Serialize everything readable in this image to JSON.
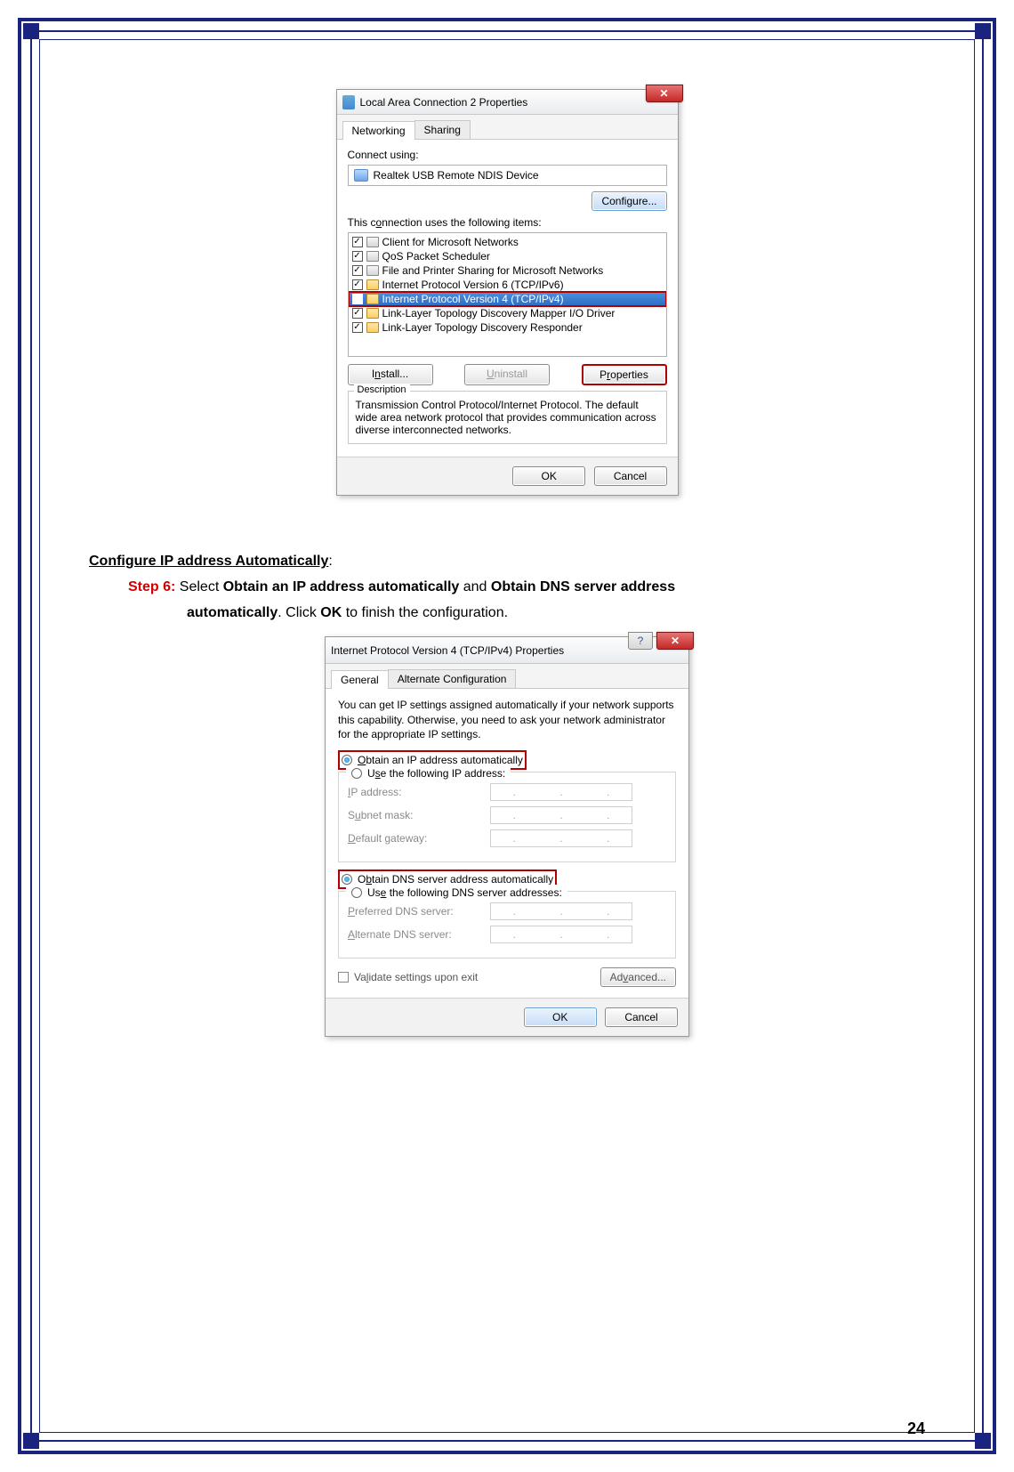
{
  "page_number": "24",
  "doc": {
    "heading": "Configure IP address Automatically",
    "step_label": "Step 6:",
    "line1_a": "Select ",
    "line1_b": "Obtain an IP address automatically",
    "line1_c": " and ",
    "line1_d": "Obtain DNS server address",
    "line2_a": "automatically",
    "line2_b": ". Click ",
    "line2_c": "OK",
    "line2_d": " to finish the configuration."
  },
  "dialog1": {
    "title": "Local Area Connection 2 Properties",
    "close": "✕",
    "tabs": {
      "networking": "Networking",
      "sharing": "Sharing"
    },
    "connect_using_label": "Connect using:",
    "adapter": "Realtek USB Remote NDIS Device",
    "configure_btn": "Configure...",
    "items_label": "This connection uses the following items:",
    "items": [
      "Client for Microsoft Networks",
      "QoS Packet Scheduler",
      "File and Printer Sharing for Microsoft Networks",
      "Internet Protocol Version 6 (TCP/IPv6)",
      "Internet Protocol Version 4 (TCP/IPv4)",
      "Link-Layer Topology Discovery Mapper I/O Driver",
      "Link-Layer Topology Discovery Responder"
    ],
    "install_btn": "Install...",
    "uninstall_btn": "Uninstall",
    "properties_btn": "Properties",
    "desc_legend": "Description",
    "description": "Transmission Control Protocol/Internet Protocol. The default wide area network protocol that provides communication across diverse interconnected networks.",
    "ok": "OK",
    "cancel": "Cancel"
  },
  "dialog2": {
    "title": "Internet Protocol Version 4 (TCP/IPv4) Properties",
    "help": "?",
    "close": "✕",
    "tabs": {
      "general": "General",
      "alt": "Alternate Configuration"
    },
    "info": "You can get IP settings assigned automatically if your network supports this capability. Otherwise, you need to ask your network administrator for the appropriate IP settings.",
    "r_obtain_ip": "Obtain an IP address automatically",
    "r_use_ip": "Use the following IP address:",
    "ip_address": "IP address:",
    "subnet": "Subnet mask:",
    "gateway": "Default gateway:",
    "r_obtain_dns": "Obtain DNS server address automatically",
    "r_use_dns": "Use the following DNS server addresses:",
    "pref_dns": "Preferred DNS server:",
    "alt_dns": "Alternate DNS server:",
    "validate": "Validate settings upon exit",
    "advanced": "Advanced...",
    "ok": "OK",
    "cancel": "Cancel"
  }
}
